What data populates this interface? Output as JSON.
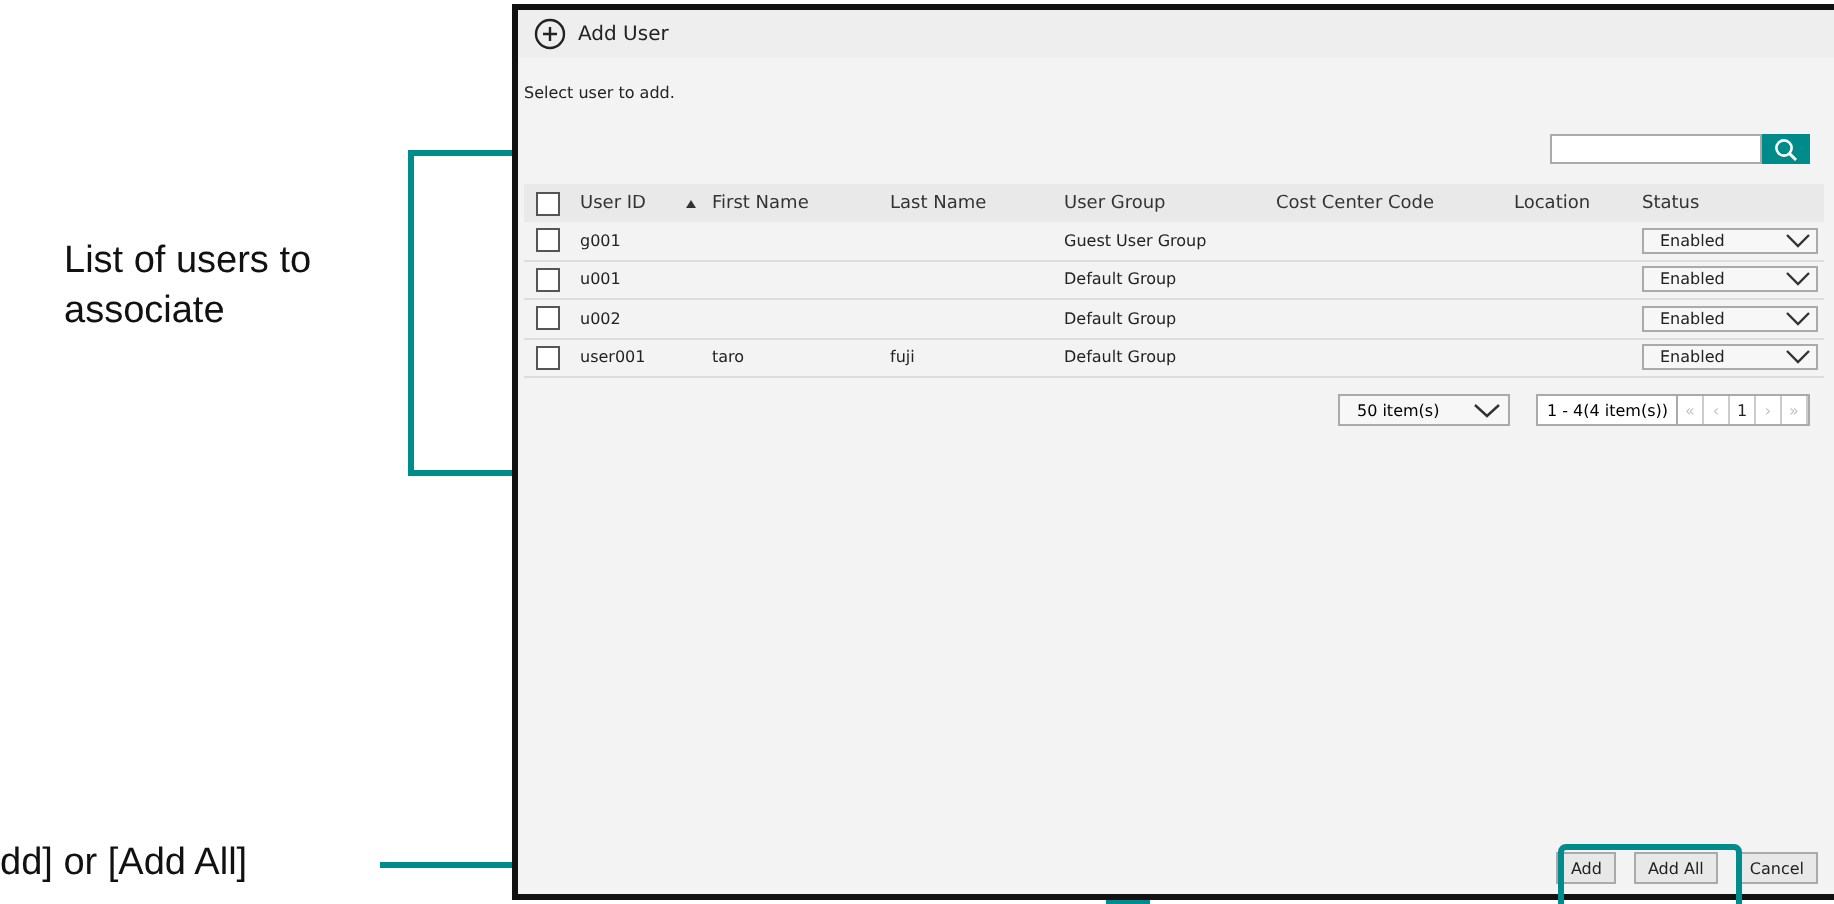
{
  "annotations": [
    {
      "kind": "bracket",
      "text": "List of users to associate"
    },
    {
      "kind": "leader",
      "text": "dd] or [Add All]"
    }
  ],
  "window": {
    "title": "Add User",
    "instruction": "Select user to add.",
    "table": {
      "columns": [
        "User ID",
        "First Name",
        "Last Name",
        "User Group",
        "Cost Center Code",
        "Location",
        "Status"
      ],
      "select_all": {
        "checked": false
      },
      "rows": [
        {
          "checked": false,
          "cells": [
            "g001",
            "",
            "",
            "Guest User Group",
            "",
            ""
          ],
          "status": "Enabled"
        },
        {
          "checked": false,
          "cells": [
            "u001",
            "",
            "",
            "Default Group",
            "",
            ""
          ],
          "status": "Enabled"
        },
        {
          "checked": false,
          "cells": [
            "u002",
            "",
            "",
            "Default Group",
            "",
            ""
          ],
          "status": "Enabled"
        },
        {
          "checked": false,
          "cells": [
            "user001",
            "taro",
            "fuji",
            "Default Group",
            "",
            ""
          ],
          "status": "Enabled"
        }
      ]
    },
    "page_size": "50 item(s)",
    "range": "1 - 4(4 item(s))",
    "pager": [
      {
        "label": "«",
        "disabled": true
      },
      {
        "label": "‹",
        "disabled": true
      },
      {
        "label": "1",
        "disabled": false
      },
      {
        "label": "›",
        "disabled": true
      },
      {
        "label": "»",
        "disabled": true
      }
    ],
    "buttons": [
      "Add",
      "Add All",
      "Cancel"
    ]
  }
}
